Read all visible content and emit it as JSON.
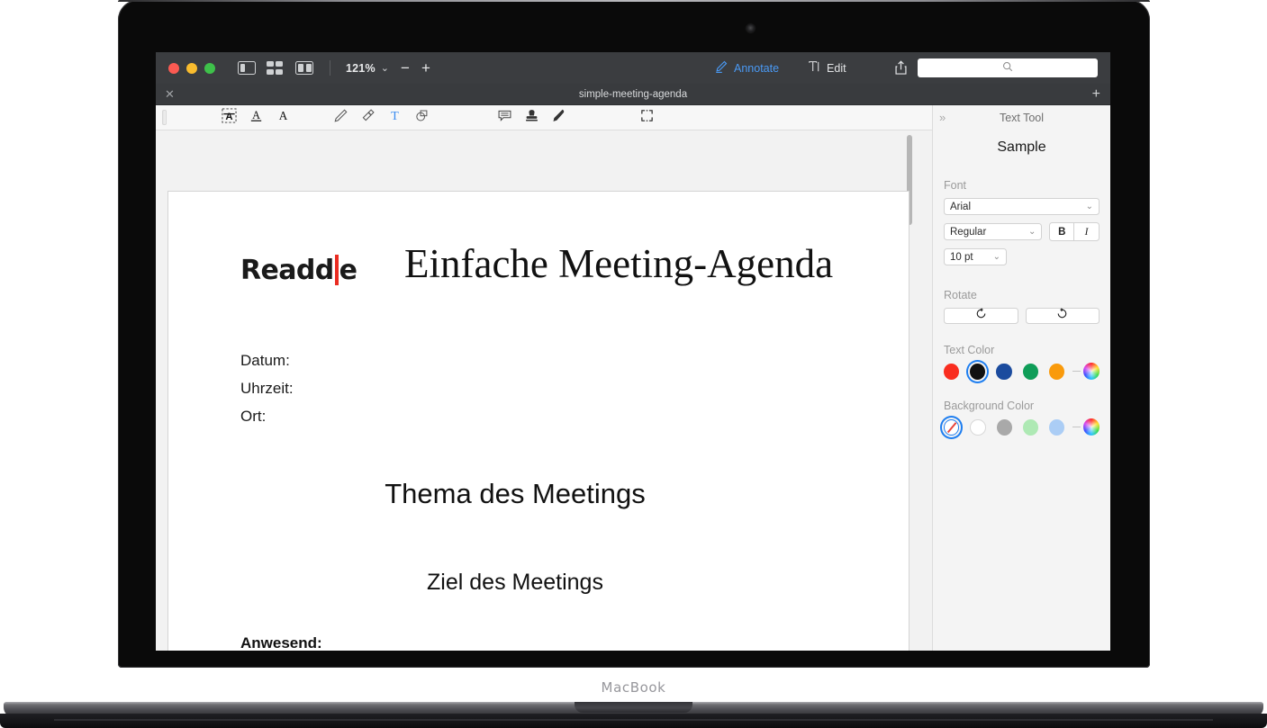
{
  "device": {
    "brand_label": "MacBook"
  },
  "titlebar": {
    "zoom_level": "121%",
    "minus_label": "−",
    "plus_label": "+",
    "chevron": "⌄",
    "view_modes": [
      {
        "name": "single-page-view",
        "label": "Single Page View"
      },
      {
        "name": "thumbnails-view",
        "label": "Thumbnails View"
      },
      {
        "name": "two-page-view",
        "label": "Two Page View"
      }
    ],
    "modes": [
      {
        "label": "Annotate",
        "icon": "pen-icon",
        "active": true
      },
      {
        "label": "Edit",
        "icon": "text-cursor-icon",
        "active": false
      }
    ],
    "share_icon": "share-icon",
    "search": {
      "value": "",
      "placeholder": "",
      "icon": "search-icon"
    }
  },
  "tabstrip": {
    "close_label": "✕",
    "title": "simple-meeting-agenda",
    "new_tab_label": "+"
  },
  "annotate_toolbar": {
    "tools": [
      {
        "name": "highlight-text-icon",
        "label": "Highlight Text"
      },
      {
        "name": "underline-text-icon",
        "label": "Underline Text"
      },
      {
        "name": "strikethrough-text-icon",
        "label": "Strikethrough Text"
      },
      {
        "name": "pencil-icon",
        "label": "Pencil"
      },
      {
        "name": "eraser-icon",
        "label": "Eraser"
      },
      {
        "name": "text-tool-icon",
        "label": "Text",
        "active": true
      },
      {
        "name": "shapes-icon",
        "label": "Shapes"
      },
      {
        "name": "note-icon",
        "label": "Note"
      },
      {
        "name": "stamp-icon",
        "label": "Stamp"
      },
      {
        "name": "signature-icon",
        "label": "Signature"
      },
      {
        "name": "select-area-icon",
        "label": "Select Area"
      }
    ],
    "active_tool_color": "#3b8cf0"
  },
  "document": {
    "logo": {
      "before": "Readd",
      "after": "e",
      "bar_color": "#ea2c21"
    },
    "title": "Einfache Meeting-Agenda",
    "fields": [
      "Datum:",
      "Uhrzeit:",
      "Ort:"
    ],
    "heading1": "Thema des Meetings",
    "heading2": "Ziel des Meetings",
    "bold_label": "Anwesend:"
  },
  "right_panel": {
    "collapse_icon": "chevron-double-right-icon",
    "title": "Text Tool",
    "sample": "Sample",
    "font_label": "Font",
    "font_family": "Arial",
    "font_style": "Regular",
    "bold_label": "B",
    "italic_label": "I",
    "font_size": "10 pt",
    "rotate_label": "Rotate",
    "rotate_ccw_icon": "rotate-counterclockwise-icon",
    "rotate_cw_icon": "rotate-clockwise-icon",
    "text_color_label": "Text Color",
    "text_colors": [
      {
        "name": "red",
        "hex": "#f92d1f",
        "selected": false
      },
      {
        "name": "black",
        "hex": "#111111",
        "selected": true
      },
      {
        "name": "blue",
        "hex": "#1b4b9e",
        "selected": false
      },
      {
        "name": "green",
        "hex": "#0f9d58",
        "selected": false
      },
      {
        "name": "orange",
        "hex": "#f99a0b",
        "selected": false
      }
    ],
    "text_color_wheel": "color-wheel-icon",
    "background_color_label": "Background Color",
    "background_colors": [
      {
        "name": "none",
        "hex": "#ffffff",
        "selected": true,
        "is_none": true
      },
      {
        "name": "white",
        "hex": "#ffffff",
        "selected": false,
        "is_none": false
      },
      {
        "name": "gray",
        "hex": "#a9a9a9",
        "selected": false,
        "is_none": false
      },
      {
        "name": "light-green",
        "hex": "#aee9b4",
        "selected": false,
        "is_none": false
      },
      {
        "name": "light-blue",
        "hex": "#abcdf5",
        "selected": false,
        "is_none": false
      }
    ],
    "background_color_wheel": "color-wheel-icon"
  }
}
